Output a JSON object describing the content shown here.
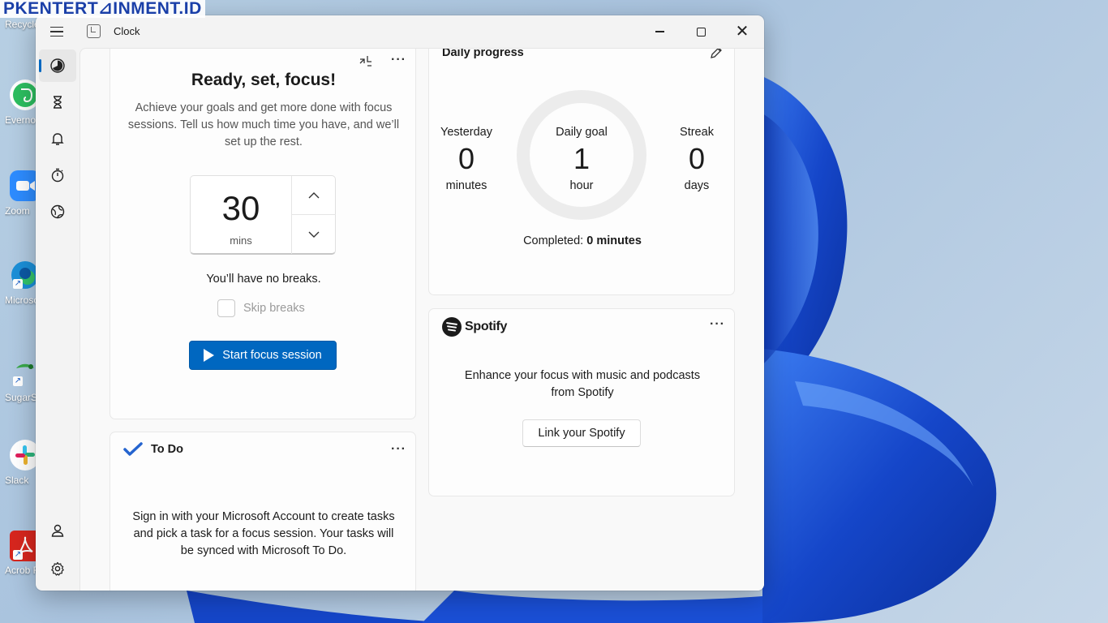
{
  "watermark": {
    "text": "PKENTERT⊿INMENT.ID"
  },
  "desktop": {
    "icons": [
      {
        "name": "recycle-bin",
        "label": "Recycle"
      },
      {
        "name": "evernote",
        "label": "Everno"
      },
      {
        "name": "zoom",
        "label": "Zoom"
      },
      {
        "name": "edge",
        "label": "Microso Edge"
      },
      {
        "name": "sugarsync",
        "label": "SugarS"
      },
      {
        "name": "slack",
        "label": "Slack"
      },
      {
        "name": "acrobat",
        "label": "Acrob Reader DC"
      }
    ],
    "shortcut_glyph": "↗"
  },
  "window": {
    "title": "Clock",
    "controls": {
      "close_glyph": "✕"
    }
  },
  "sidebar": {
    "items": [
      {
        "name": "focus-sessions",
        "icon": "focus-icon",
        "active": true
      },
      {
        "name": "timer",
        "icon": "hourglass-icon"
      },
      {
        "name": "alarm",
        "icon": "bell-icon"
      },
      {
        "name": "stopwatch",
        "icon": "stopwatch-icon"
      },
      {
        "name": "world-clock",
        "icon": "globe-icon"
      }
    ],
    "bottom": [
      {
        "name": "account",
        "icon": "person-icon"
      },
      {
        "name": "settings",
        "icon": "gear-icon"
      }
    ]
  },
  "focus": {
    "title": "Ready, set, focus!",
    "description": "Achieve your goals and get more done with focus sessions. Tell us how much time you have, and we’ll set up the rest.",
    "minutes_value": "30",
    "minutes_unit": "mins",
    "breaks_text": "You’ll have no breaks.",
    "skip_breaks_label": "Skip breaks",
    "skip_breaks_checked": false,
    "start_label": "Start focus session",
    "more_label": "···"
  },
  "progress": {
    "title": "Daily progress",
    "yesterday": {
      "label": "Yesterday",
      "value": "0",
      "unit": "minutes"
    },
    "goal": {
      "label": "Daily goal",
      "value": "1",
      "unit": "hour"
    },
    "streak": {
      "label": "Streak",
      "value": "0",
      "unit": "days"
    },
    "goal_fraction": 0,
    "completed_label": "Completed:",
    "completed_value": "0 minutes"
  },
  "spotify": {
    "brand": "Spotify",
    "more_label": "···",
    "description": "Enhance your focus with music and podcasts from Spotify",
    "link_label": "Link your Spotify"
  },
  "todo": {
    "title": "To Do",
    "more_label": "···",
    "description": "Sign in with your Microsoft Account to create tasks and pick a task for a focus session. Your tasks will be synced with Microsoft To Do."
  },
  "colors": {
    "accent": "#0067c0",
    "wallpaper_blue": "#1a4fd6",
    "todo_check": "#2564cf"
  }
}
